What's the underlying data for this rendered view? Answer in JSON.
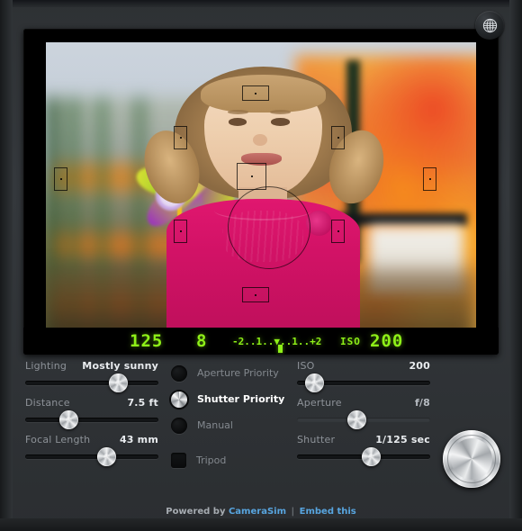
{
  "app": {
    "title": "CameraSim",
    "globe_icon": "globe-icon"
  },
  "viewfinder": {
    "scene_description": "Young girl in pink shirt holding a pinwheel at a playground",
    "af_points_count": 9,
    "metering_circle": true,
    "lcd": {
      "shutter": "125",
      "aperture": "8",
      "meter_scale": "-2..1..▼..1..+2",
      "iso_label": "ISO",
      "iso_value": "200"
    }
  },
  "controls": {
    "left": [
      {
        "name": "lighting",
        "label": "Lighting",
        "value": "Mostly sunny",
        "pos": 70,
        "enabled": true
      },
      {
        "name": "distance",
        "label": "Distance",
        "value": "7.5 ft",
        "pos": 33,
        "enabled": true
      },
      {
        "name": "focal-length",
        "label": "Focal Length",
        "value": "43 mm",
        "pos": 61,
        "enabled": true
      }
    ],
    "modes": {
      "options": [
        {
          "label": "Aperture Priority",
          "selected": false
        },
        {
          "label": "Shutter Priority",
          "selected": true
        },
        {
          "label": "Manual",
          "selected": false
        }
      ],
      "tripod": {
        "label": "Tripod",
        "checked": false
      }
    },
    "right": [
      {
        "name": "iso",
        "label": "ISO",
        "value": "200",
        "pos": 13,
        "enabled": true
      },
      {
        "name": "aperture",
        "label": "Aperture",
        "value": "f/8",
        "pos": 45,
        "enabled": false
      },
      {
        "name": "shutter",
        "label": "Shutter",
        "value": "1/125 sec",
        "pos": 56,
        "enabled": true
      }
    ],
    "shutter_release": "Shutter release button"
  },
  "footer": {
    "prefix": "Powered by",
    "brand": "CameraSim",
    "separator": "|",
    "embed": "Embed this"
  },
  "colors": {
    "lcd_green": "#8ef018",
    "link_blue": "#58a5e0",
    "shirt_pink": "#d21266",
    "panel_bg": "#34383c"
  }
}
